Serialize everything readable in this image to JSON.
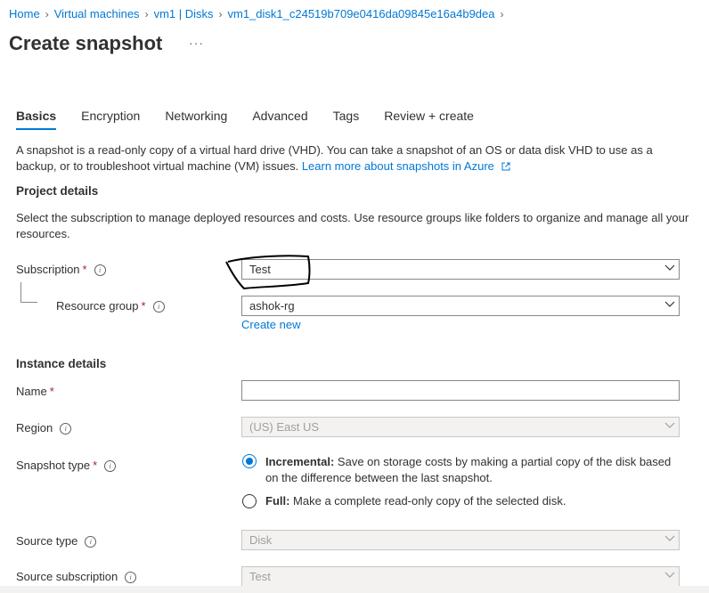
{
  "breadcrumb": [
    {
      "label": "Home"
    },
    {
      "label": "Virtual machines"
    },
    {
      "label": "vm1 | Disks"
    },
    {
      "label": "vm1_disk1_c24519b709e0416da09845e16a4b9dea"
    }
  ],
  "page": {
    "title": "Create snapshot",
    "more": "···"
  },
  "tabs": [
    {
      "label": "Basics"
    },
    {
      "label": "Encryption"
    },
    {
      "label": "Networking"
    },
    {
      "label": "Advanced"
    },
    {
      "label": "Tags"
    },
    {
      "label": "Review + create"
    }
  ],
  "intro": {
    "text": "A snapshot is a read-only copy of a virtual hard drive (VHD). You can take a snapshot of an OS or data disk VHD to use as a backup, or to troubleshoot virtual machine (VM) issues. ",
    "link": "Learn more about snapshots in Azure"
  },
  "project": {
    "heading": "Project details",
    "description": "Select the subscription to manage deployed resources and costs. Use resource groups like folders to organize and manage all your resources.",
    "subscription_label": "Subscription",
    "subscription_value": "Test",
    "resource_group_label": "Resource group",
    "resource_group_value": "ashok-rg",
    "create_new": "Create new"
  },
  "instance": {
    "heading": "Instance details",
    "name_label": "Name",
    "name_value": "",
    "region_label": "Region",
    "region_value": "(US) East US",
    "snapshot_type_label": "Snapshot type",
    "incremental_title": "Incremental:",
    "incremental_desc": " Save on storage costs by making a partial copy of the disk based on the difference between the last snapshot.",
    "full_title": "Full:",
    "full_desc": " Make a complete read-only copy of the selected disk.",
    "source_type_label": "Source type",
    "source_type_value": "Disk",
    "source_subscription_label": "Source subscription",
    "source_subscription_value": "Test"
  },
  "required_marker": "*",
  "info_glyph": "i"
}
